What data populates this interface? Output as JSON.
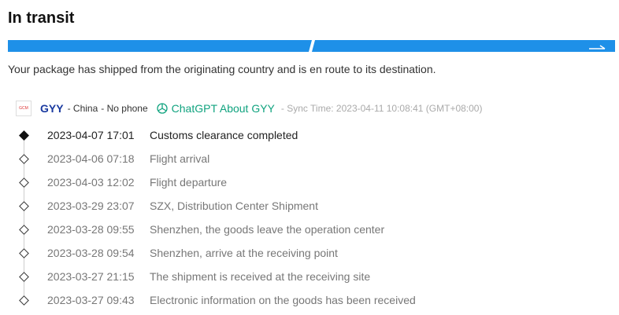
{
  "status": {
    "title": "In transit",
    "description": "Your package has shipped from the originating country and is en route to its destination."
  },
  "colors": {
    "progress": "#1e90e8",
    "carrier": "#1a3aa0",
    "chatgpt": "#10a37f"
  },
  "carrier": {
    "logo_text": "GCM",
    "name": "GYY",
    "country": "- China",
    "phone": "- No phone",
    "chatgpt_label": "ChatGPT About GYY",
    "sync_time": "- Sync Time: 2023-04-11 10:08:41 (GMT+08:00)"
  },
  "events": [
    {
      "date": "2023-04-07 17:01",
      "desc": "Customs clearance completed"
    },
    {
      "date": "2023-04-06 07:18",
      "desc": "Flight arrival"
    },
    {
      "date": "2023-04-03 12:02",
      "desc": "Flight departure"
    },
    {
      "date": "2023-03-29 23:07",
      "desc": "SZX, Distribution Center Shipment"
    },
    {
      "date": "2023-03-28 09:55",
      "desc": "Shenzhen, the goods leave the operation center"
    },
    {
      "date": "2023-03-28 09:54",
      "desc": "Shenzhen, arrive at the receiving point"
    },
    {
      "date": "2023-03-27 21:15",
      "desc": "The shipment is received at the receiving site"
    },
    {
      "date": "2023-03-27 09:43",
      "desc": "Electronic information on the goods has been received"
    }
  ]
}
